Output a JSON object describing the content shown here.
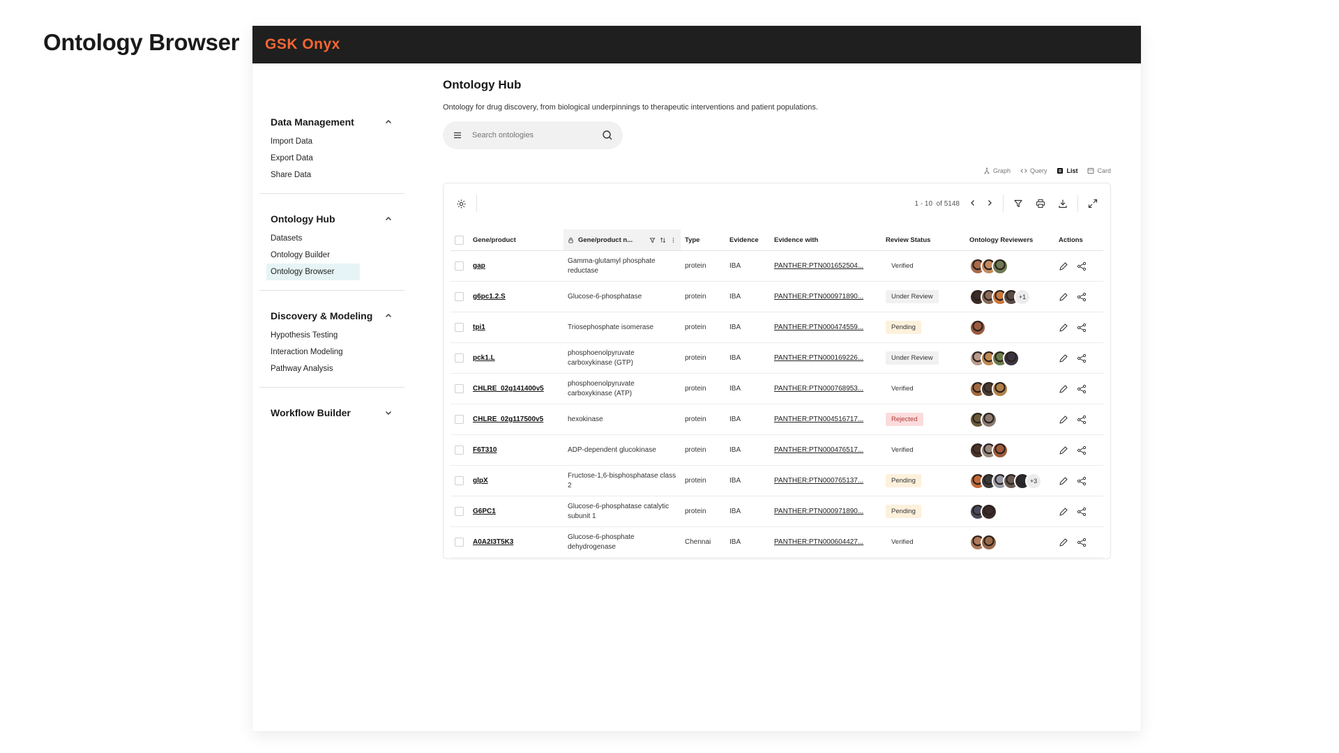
{
  "page": {
    "heading": "Ontology Browser"
  },
  "brand": {
    "logo": "GSK Onyx",
    "accent": "#f36633"
  },
  "sidebar": {
    "sections": [
      {
        "title": "Data Management",
        "expanded": true,
        "items": [
          "Import Data",
          "Export Data",
          "Share Data"
        ]
      },
      {
        "title": "Ontology Hub",
        "expanded": true,
        "items": [
          "Datasets",
          "Ontology Builder",
          "Ontology Browser"
        ],
        "active": "Ontology Browser"
      },
      {
        "title": "Discovery & Modeling",
        "expanded": true,
        "items": [
          "Hypothesis Testing",
          "Interaction Modeling",
          "Pathway Analysis"
        ]
      },
      {
        "title": "Workflow Builder",
        "expanded": false,
        "items": []
      }
    ]
  },
  "main": {
    "title": "Ontology Hub",
    "description": "Ontology for drug discovery, from biological underpinnings to therapeutic interventions and patient populations.",
    "search_placeholder": "Search ontologies",
    "views": [
      {
        "label": "Graph",
        "icon": "graph-icon",
        "active": false
      },
      {
        "label": "Query",
        "icon": "code-icon",
        "active": false
      },
      {
        "label": "List",
        "icon": "list-icon",
        "active": true
      },
      {
        "label": "Card",
        "icon": "card-icon",
        "active": false
      }
    ],
    "pager": {
      "range": "1 - 10",
      "total": "of 5148"
    }
  },
  "table": {
    "headers": [
      "Gene/product",
      "Gene/product n...",
      "Type",
      "Evidence",
      "Evidence with",
      "Review Status",
      "Ontology Reviewers",
      "Actions"
    ],
    "rows": [
      {
        "gene": "gap",
        "name": "Gamma-glutamyl phosphate reductase",
        "type": "protein",
        "evidence": "IBA",
        "evidence_with": "PANTHER:PTN001652504...",
        "status": "Verified",
        "status_kind": "verified",
        "avatars": [
          "#a86a4a",
          "#c48a5c",
          "#6f7a52"
        ],
        "more": ""
      },
      {
        "gene": "g6pc1.2.S",
        "name": "Glucose-6-phosphatase",
        "type": "protein",
        "evidence": "IBA",
        "evidence_with": "PANTHER:PTN000971890...",
        "status": "Under Review",
        "status_kind": "review",
        "avatars": [
          "#3a2c26",
          "#8a6a58",
          "#c9773a",
          "#5a4a44"
        ],
        "more": "+1"
      },
      {
        "gene": "tpi1",
        "name": "Triosephosphate isomerase",
        "type": "protein",
        "evidence": "IBA",
        "evidence_with": "PANTHER:PTN000474559...",
        "status": "Pending",
        "status_kind": "pending",
        "avatars": [
          "#9a5a3e"
        ],
        "more": ""
      },
      {
        "gene": "pck1.L",
        "name": "phosphoenolpyruvate carboxykinase (GTP)",
        "type": "protein",
        "evidence": "IBA",
        "evidence_with": "PANTHER:PTN000169226...",
        "status": "Under Review",
        "status_kind": "review",
        "avatars": [
          "#b89a8a",
          "#c08850",
          "#6a7a4a",
          "#3a3440"
        ],
        "more": ""
      },
      {
        "gene": "CHLRE_02g141400v5",
        "name": "phosphoenolpyruvate carboxykinase (ATP)",
        "type": "protein",
        "evidence": "IBA",
        "evidence_with": "PANTHER:PTN000768953...",
        "status": "Verified",
        "status_kind": "verified",
        "avatars": [
          "#a0683e",
          "#4a3a30",
          "#b0804a"
        ],
        "more": ""
      },
      {
        "gene": "CHLRE_02g117500v5",
        "name": "hexokinase",
        "type": "protein",
        "evidence": "IBA",
        "evidence_with": "PANTHER:PTN004516717...",
        "status": "Rejected",
        "status_kind": "rejected",
        "avatars": [
          "#6a5a3a",
          "#8a7a70"
        ],
        "more": ""
      },
      {
        "gene": "F6T310",
        "name": "ADP-dependent glucokinase",
        "type": "protein",
        "evidence": "IBA",
        "evidence_with": "PANTHER:PTN000476517...",
        "status": "Verified",
        "status_kind": "verified",
        "avatars": [
          "#4a342a",
          "#9a8a7e",
          "#a05a3a"
        ],
        "more": ""
      },
      {
        "gene": "glpX",
        "name": "Fructose-1,6-bisphosphatase class 2",
        "type": "protein",
        "evidence": "IBA",
        "evidence_with": "PANTHER:PTN000765137...",
        "status": "Pending",
        "status_kind": "pending",
        "avatars": [
          "#c06a3a",
          "#3a3a3a",
          "#9a9aa4",
          "#6a5a50",
          "#2a2a2a"
        ],
        "more": "+3"
      },
      {
        "gene": "G6PC1",
        "name": "Glucose-6-phosphatase catalytic subunit 1",
        "type": "protein",
        "evidence": "IBA",
        "evidence_with": "PANTHER:PTN000971890...",
        "status": "Pending",
        "status_kind": "pending",
        "avatars": [
          "#4a4a5a",
          "#3a2a28"
        ],
        "more": ""
      },
      {
        "gene": "A0A2I3T5K3",
        "name": "Glucose-6-phosphate dehydrogenase",
        "type": "Chennai",
        "evidence": "IBA",
        "evidence_with": "PANTHER:PTN000604427...",
        "status": "Verified",
        "status_kind": "verified",
        "avatars": [
          "#b07a5a",
          "#9a6a4a"
        ],
        "more": ""
      }
    ]
  }
}
